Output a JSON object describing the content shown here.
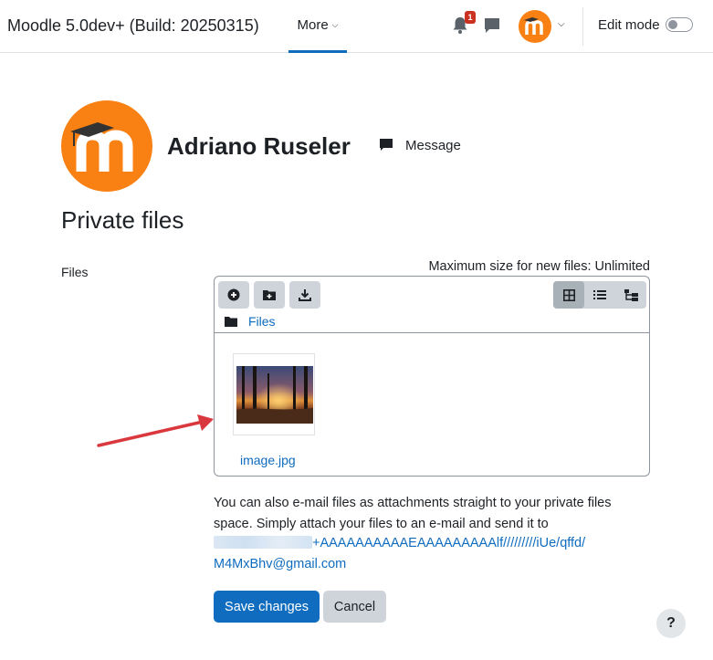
{
  "navbar": {
    "site_name": "Moodle 5.0dev+ (Build: 20250315)",
    "more_label": "More",
    "notification_count": "1",
    "edit_mode_label": "Edit mode"
  },
  "profile": {
    "name": "Adriano Ruseler",
    "message_label": "Message"
  },
  "page": {
    "title": "Private files"
  },
  "form": {
    "files_label": "Files",
    "max_size": "Maximum size for new files: Unlimited"
  },
  "filemanager": {
    "breadcrumb": "Files",
    "files": [
      {
        "name": "image.jpg"
      }
    ]
  },
  "info": {
    "text": "You can also e-mail files as attachments straight to your private files space. Simply attach your files to an e-mail and send it to",
    "email_visible_part1": "+AAAAAAAAAAEAAAAAAAAAlf/////////iUe/qffd/",
    "email_visible_part2": "M4MxBhv@gmail.com"
  },
  "actions": {
    "save_label": "Save changes",
    "cancel_label": "Cancel",
    "help_label": "?"
  },
  "colors": {
    "accent": "#0f6cbf",
    "brand": "#f98012",
    "annotation_arrow": "#d9393e"
  }
}
